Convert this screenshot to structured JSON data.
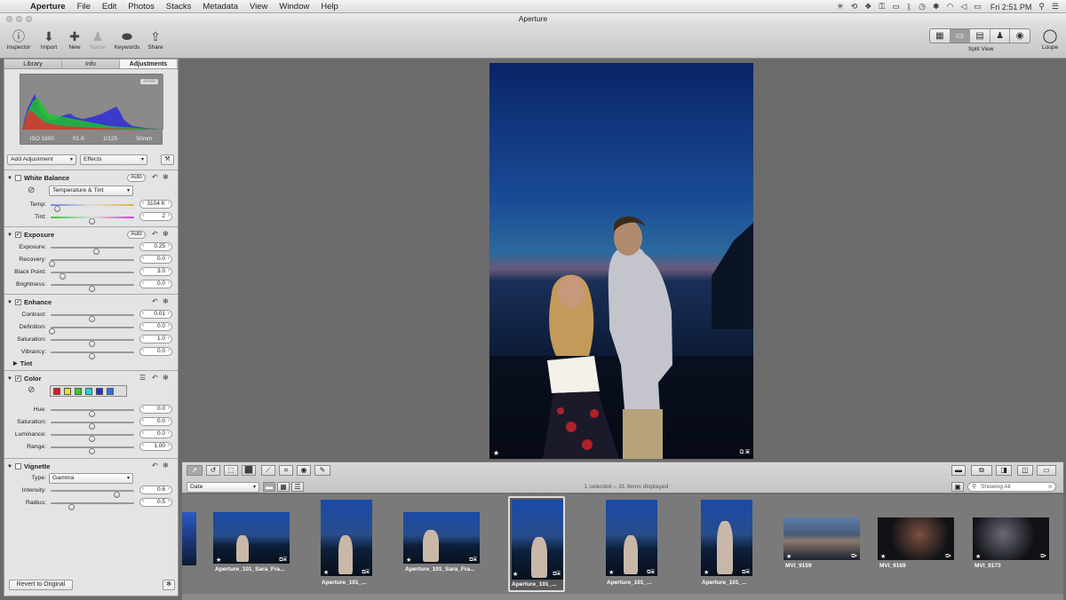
{
  "menubar": {
    "app": "Aperture",
    "items": [
      "File",
      "Edit",
      "Photos",
      "Stacks",
      "Metadata",
      "View",
      "Window",
      "Help"
    ],
    "clock": "Fri 2:51 PM"
  },
  "window": {
    "title": "Aperture"
  },
  "toolbar": {
    "inspector": "Inspector",
    "import": "Import",
    "new": "New",
    "name": "Name",
    "keywords": "Keywords",
    "share": "Share",
    "split_view": "Split View",
    "loupe": "Loupe"
  },
  "inspector": {
    "tabs": [
      "Library",
      "Info",
      "Adjustments"
    ],
    "active_tab": "Adjustments",
    "histogram": {
      "badge": "RAW",
      "iso": "ISO 1600",
      "aperture": "f/1.6",
      "shutter": "1/125",
      "focal": "50mm"
    },
    "add_adjustment": "Add Adjustment",
    "effects": "Effects",
    "auto_label": "Auto",
    "white_balance": {
      "title": "White Balance",
      "mode": "Temperature & Tint",
      "temp_label": "Temp:",
      "temp_value": "3104 K",
      "temp_pos": 0.08,
      "tint_label": "Tint:",
      "tint_value": "2",
      "tint_pos": 0.5
    },
    "exposure": {
      "title": "Exposure",
      "rows": [
        {
          "label": "Exposure:",
          "value": "0.25",
          "pos": 0.55
        },
        {
          "label": "Recovery:",
          "value": "0.0",
          "pos": 0.02
        },
        {
          "label": "Black Point:",
          "value": "3.0",
          "pos": 0.15
        },
        {
          "label": "Brightness:",
          "value": "0.0",
          "pos": 0.5
        }
      ]
    },
    "enhance": {
      "title": "Enhance",
      "rows": [
        {
          "label": "Contrast:",
          "value": "0.01",
          "pos": 0.5
        },
        {
          "label": "Definition:",
          "value": "0.0",
          "pos": 0.02
        },
        {
          "label": "Saturation:",
          "value": "1.0",
          "pos": 0.5
        },
        {
          "label": "Vibrancy:",
          "value": "0.0",
          "pos": 0.5
        }
      ],
      "tint": "Tint"
    },
    "color": {
      "title": "Color",
      "swatches": [
        "#d81e1e",
        "#e8e020",
        "#30d030",
        "#30d0d0",
        "#2030d8",
        "#3070e0"
      ],
      "rows": [
        {
          "label": "Hue:",
          "value": "0.0",
          "pos": 0.5
        },
        {
          "label": "Saturation:",
          "value": "0.0",
          "pos": 0.5
        },
        {
          "label": "Luminance:",
          "value": "0.0",
          "pos": 0.5
        },
        {
          "label": "Range:",
          "value": "1.00",
          "pos": 0.5
        }
      ]
    },
    "vignette": {
      "title": "Vignette",
      "type_label": "Type:",
      "type_value": "Gamma",
      "rows": [
        {
          "label": "Intensity:",
          "value": "0.6",
          "pos": 0.8
        },
        {
          "label": "Radius:",
          "value": "0.5",
          "pos": 0.25
        }
      ]
    },
    "revert": "Revert to Original"
  },
  "browser": {
    "sort": "Date",
    "status": "1 selected – 31 items displayed",
    "search": "Showing All"
  },
  "filmstrip": [
    {
      "caption": "",
      "w": 16
    },
    {
      "caption": "Aperture_101_Sara_Fra...",
      "w": 86
    },
    {
      "caption": "Aperture_101_...",
      "w": 58
    },
    {
      "caption": "Aperture_101_Sara_Fra...",
      "w": 86
    },
    {
      "caption": "Aperture_101_...",
      "w": 58,
      "selected": true
    },
    {
      "caption": "Aperture_101_...",
      "w": 58
    },
    {
      "caption": "Aperture_101_...",
      "w": 58
    },
    {
      "caption": "MVI_9159",
      "w": 86
    },
    {
      "caption": "MVI_9169",
      "w": 86
    },
    {
      "caption": "MVI_9173",
      "w": 86
    }
  ],
  "colors": {
    "accent": "#8a8a8a",
    "sky_top": "#0b2a7a",
    "sky_mid": "#1b4f8f",
    "sea": "#0a1830"
  }
}
